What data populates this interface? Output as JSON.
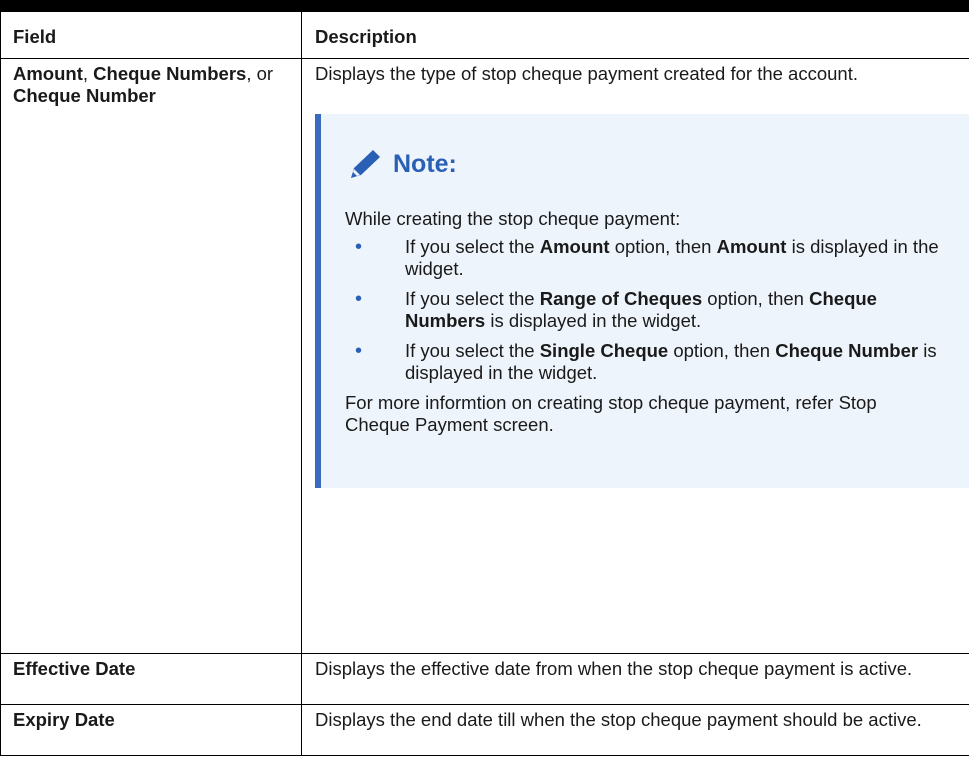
{
  "table": {
    "header": {
      "field": "Field",
      "description": "Description"
    },
    "rows": [
      {
        "field_parts": [
          {
            "text": "Amount",
            "bold": true
          },
          {
            "text": ", ",
            "bold": false
          },
          {
            "text": "Cheque Numbers",
            "bold": true
          },
          {
            "text": ", or ",
            "bold": false
          },
          {
            "text": "Cheque Number",
            "bold": true
          }
        ],
        "description": "Displays the type of stop cheque payment created for the account.",
        "note": {
          "icon": "pencil-icon",
          "title": "Note:",
          "intro": "While creating the stop cheque payment:",
          "bullets": [
            {
              "parts": [
                {
                  "text": "If you select the ",
                  "bold": false
                },
                {
                  "text": "Amount",
                  "bold": true
                },
                {
                  "text": " option, then ",
                  "bold": false
                },
                {
                  "text": "Amount",
                  "bold": true
                },
                {
                  "text": " is displayed in the widget.",
                  "bold": false
                }
              ]
            },
            {
              "parts": [
                {
                  "text": "If you select the ",
                  "bold": false
                },
                {
                  "text": "Range of Cheques",
                  "bold": true
                },
                {
                  "text": " option, then ",
                  "bold": false
                },
                {
                  "text": "Cheque Numbers",
                  "bold": true
                },
                {
                  "text": " is displayed in the widget.",
                  "bold": false
                }
              ]
            },
            {
              "parts": [
                {
                  "text": "If you select the ",
                  "bold": false
                },
                {
                  "text": "Single Cheque",
                  "bold": true
                },
                {
                  "text": " option, then ",
                  "bold": false
                },
                {
                  "text": "Cheque Number",
                  "bold": true
                },
                {
                  "text": " is displayed in the widget.",
                  "bold": false
                }
              ]
            }
          ],
          "outro": "For more informtion on creating stop cheque payment, refer Stop Cheque Payment screen."
        }
      },
      {
        "field": "Effective Date",
        "description": "Displays the effective date from when the stop cheque payment is active."
      },
      {
        "field": "Expiry Date",
        "description": "Displays the end date till when the stop cheque payment should be active."
      }
    ]
  },
  "colors": {
    "note_accent": "#3a6bbf",
    "note_bg": "#eef4fb",
    "note_title": "#2a5fb6",
    "rule": "#000000"
  }
}
